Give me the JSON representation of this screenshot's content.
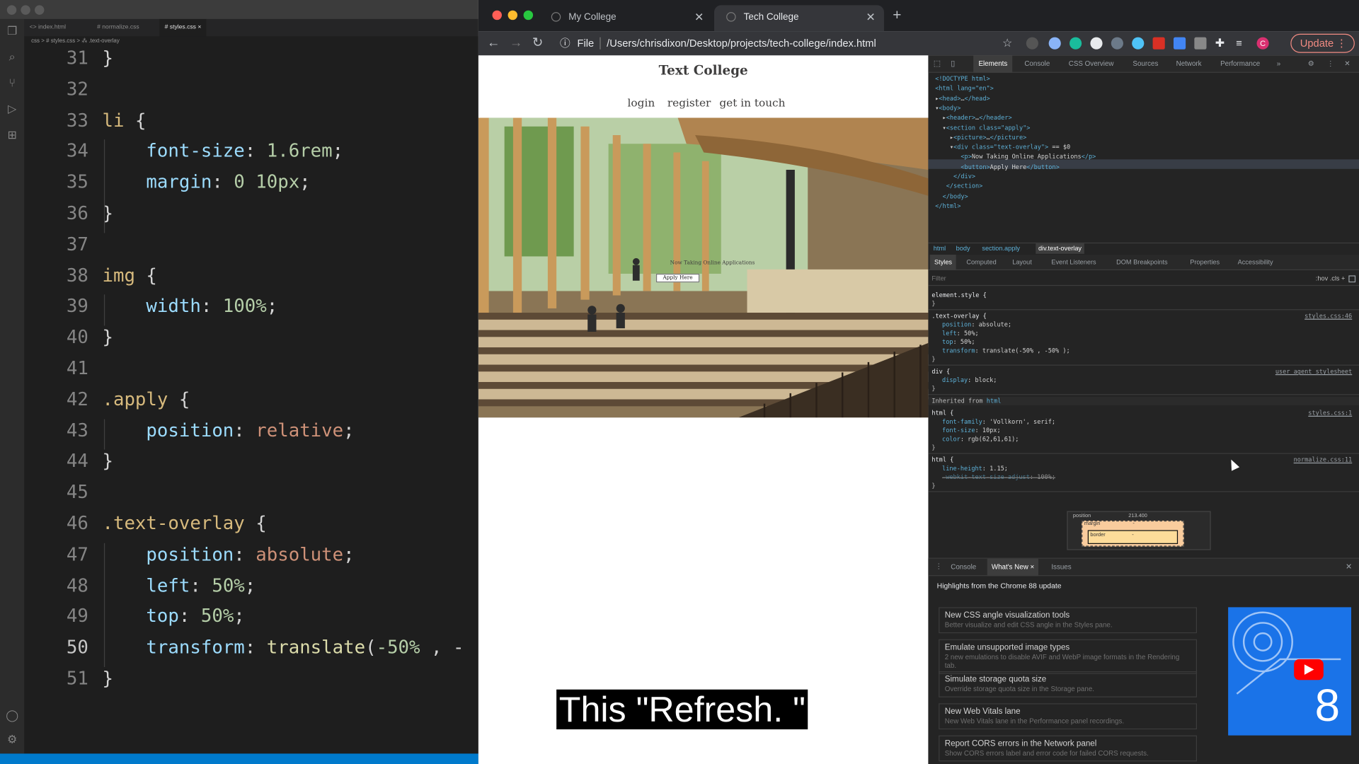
{
  "vscode": {
    "tabs": [
      "<> index.html",
      "# normalize.css",
      "# styles.css ×"
    ],
    "breadcrumb": "css > # styles.css > ⁂ .text-overlay",
    "lines": [
      {
        "n": "31",
        "t": [
          {
            "c": "",
            "s": "}"
          }
        ]
      },
      {
        "n": "32",
        "t": []
      },
      {
        "n": "33",
        "t": [
          {
            "c": "sel",
            "s": "li"
          },
          {
            "c": "",
            "s": " {"
          }
        ]
      },
      {
        "n": "34",
        "t": [
          {
            "c": "",
            "s": "    "
          },
          {
            "c": "prop",
            "s": "font-size"
          },
          {
            "c": "",
            "s": ": "
          },
          {
            "c": "num",
            "s": "1.6rem"
          },
          {
            "c": "",
            "s": ";"
          }
        ]
      },
      {
        "n": "35",
        "t": [
          {
            "c": "",
            "s": "    "
          },
          {
            "c": "prop",
            "s": "margin"
          },
          {
            "c": "",
            "s": ": "
          },
          {
            "c": "num",
            "s": "0 10px"
          },
          {
            "c": "",
            "s": ";"
          }
        ]
      },
      {
        "n": "36",
        "t": [
          {
            "c": "",
            "s": "}"
          }
        ]
      },
      {
        "n": "37",
        "t": []
      },
      {
        "n": "38",
        "t": [
          {
            "c": "sel",
            "s": "img"
          },
          {
            "c": "",
            "s": " {"
          }
        ]
      },
      {
        "n": "39",
        "t": [
          {
            "c": "",
            "s": "    "
          },
          {
            "c": "prop",
            "s": "width"
          },
          {
            "c": "",
            "s": ": "
          },
          {
            "c": "num",
            "s": "100%"
          },
          {
            "c": "",
            "s": ";"
          }
        ]
      },
      {
        "n": "40",
        "t": [
          {
            "c": "",
            "s": "}"
          }
        ]
      },
      {
        "n": "41",
        "t": []
      },
      {
        "n": "42",
        "t": [
          {
            "c": "sel",
            "s": ".apply"
          },
          {
            "c": "",
            "s": " {"
          }
        ]
      },
      {
        "n": "43",
        "t": [
          {
            "c": "",
            "s": "    "
          },
          {
            "c": "prop",
            "s": "position"
          },
          {
            "c": "",
            "s": ": "
          },
          {
            "c": "val",
            "s": "relative"
          },
          {
            "c": "",
            "s": ";"
          }
        ]
      },
      {
        "n": "44",
        "t": [
          {
            "c": "",
            "s": "}"
          }
        ]
      },
      {
        "n": "45",
        "t": []
      },
      {
        "n": "46",
        "t": [
          {
            "c": "sel",
            "s": ".text-overlay"
          },
          {
            "c": "",
            "s": " {"
          }
        ]
      },
      {
        "n": "47",
        "t": [
          {
            "c": "",
            "s": "    "
          },
          {
            "c": "prop",
            "s": "position"
          },
          {
            "c": "",
            "s": ": "
          },
          {
            "c": "val",
            "s": "absolute"
          },
          {
            "c": "",
            "s": ";"
          }
        ]
      },
      {
        "n": "48",
        "t": [
          {
            "c": "",
            "s": "    "
          },
          {
            "c": "prop",
            "s": "left"
          },
          {
            "c": "",
            "s": ": "
          },
          {
            "c": "num",
            "s": "50%"
          },
          {
            "c": "",
            "s": ";"
          }
        ]
      },
      {
        "n": "49",
        "t": [
          {
            "c": "",
            "s": "    "
          },
          {
            "c": "prop",
            "s": "top"
          },
          {
            "c": "",
            "s": ": "
          },
          {
            "c": "num",
            "s": "50%"
          },
          {
            "c": "",
            "s": ";"
          }
        ]
      },
      {
        "n": "50",
        "t": [
          {
            "c": "",
            "s": "    "
          },
          {
            "c": "prop",
            "s": "transform"
          },
          {
            "c": "",
            "s": ": "
          },
          {
            "c": "fn",
            "s": "translate"
          },
          {
            "c": "",
            "s": "("
          },
          {
            "c": "num",
            "s": "-50%"
          },
          {
            "c": "",
            "s": " , -"
          }
        ]
      },
      {
        "n": "51",
        "t": [
          {
            "c": "",
            "s": "}"
          }
        ]
      }
    ],
    "current_line": "50"
  },
  "browser": {
    "tabs": [
      {
        "title": "My College",
        "active": false
      },
      {
        "title": "Tech College",
        "active": true
      }
    ],
    "url_scheme": "File",
    "url": "/Users/chrisdixon/Desktop/projects/tech-college/index.html",
    "update_label": "Update",
    "profile_initial": "C"
  },
  "site": {
    "title": "Text College",
    "nav": [
      "login",
      "register",
      "get in touch"
    ],
    "overlay_text": "Now Taking Online Applications",
    "button": "Apply Here"
  },
  "devtools": {
    "tabs": [
      "Elements",
      "Console",
      "CSS Overview",
      "Sources",
      "Network",
      "Performance"
    ],
    "dom_lines": [
      "<!DOCTYPE html>",
      "<html lang=\"en\">",
      "▸<head>…</head>",
      "▾<body>",
      "  ▸<header>…</header>",
      "  ▾<section class=\"apply\">",
      "    ▸<picture>…</picture>",
      "    ▾<div class=\"text-overlay\"> == $0",
      "       <p>Now Taking Online Applications</p>",
      "       <button>Apply Here</button>",
      "     </div>",
      "   </section>",
      "  </body>",
      "</html>"
    ],
    "crumbs": [
      "html",
      "body",
      "section.apply",
      "div.text-overlay"
    ],
    "subtabs": [
      "Styles",
      "Computed",
      "Layout",
      "Event Listeners",
      "DOM Breakpoints",
      "Properties",
      "Accessibility"
    ],
    "filter_placeholder": "Filter",
    "filter_tools": ":hov  .cls  +",
    "styles": [
      {
        "sel": "element.style {",
        "src": "",
        "props": [],
        "close": "}"
      },
      {
        "sel": ".text-overlay {",
        "src": "styles.css:46",
        "props": [
          [
            "position",
            "absolute;"
          ],
          [
            "left",
            "50%;"
          ],
          [
            "top",
            "50%;"
          ],
          [
            "transform",
            "translate(-50% , -50% );"
          ]
        ],
        "close": "}"
      },
      {
        "sel": "div {",
        "src": "user agent stylesheet",
        "props": [
          [
            "display",
            "block;"
          ]
        ],
        "close": "}"
      }
    ],
    "inherited_label": "Inherited from ",
    "inherited_from": "html",
    "inherited": [
      {
        "sel": "html {",
        "src": "styles.css:1",
        "props": [
          [
            "font-family",
            "'Vollkorn', serif;"
          ],
          [
            "font-size",
            "10px;"
          ],
          [
            "color",
            "rgb(62,61,61);"
          ]
        ],
        "close": "}"
      },
      {
        "sel": "html {",
        "src": "normalize.css:11",
        "props": [
          [
            "line-height",
            "1.15;"
          ],
          [
            "-webkit-text-size-adjust",
            "100%;"
          ]
        ],
        "close": "}"
      }
    ],
    "boxmodel": {
      "label": "position",
      "value": "213.400",
      "margin": "margin",
      "border": "border",
      "dash": "-"
    },
    "drawer_tabs": [
      "Console",
      "What's New ×",
      "Issues"
    ],
    "drawer_heading": "Highlights from the Chrome 88 update",
    "whats_new": [
      {
        "title": "New CSS angle visualization tools",
        "desc": "Better visualize and edit CSS angle in the Styles pane."
      },
      {
        "title": "Emulate unsupported image types",
        "desc": "2 new emulations to disable AVIF and WebP image formats in the Rendering tab."
      },
      {
        "title": "Simulate storage quota size",
        "desc": "Override storage quota size in the Storage pane."
      },
      {
        "title": "New Web Vitals lane",
        "desc": "New Web Vitals lane in the Performance panel recordings."
      },
      {
        "title": "Report CORS errors in the Network panel",
        "desc": "Show CORS errors label and error code for failed CORS requests."
      }
    ],
    "promo_number": "8"
  },
  "caption": "This \"Refresh. \""
}
